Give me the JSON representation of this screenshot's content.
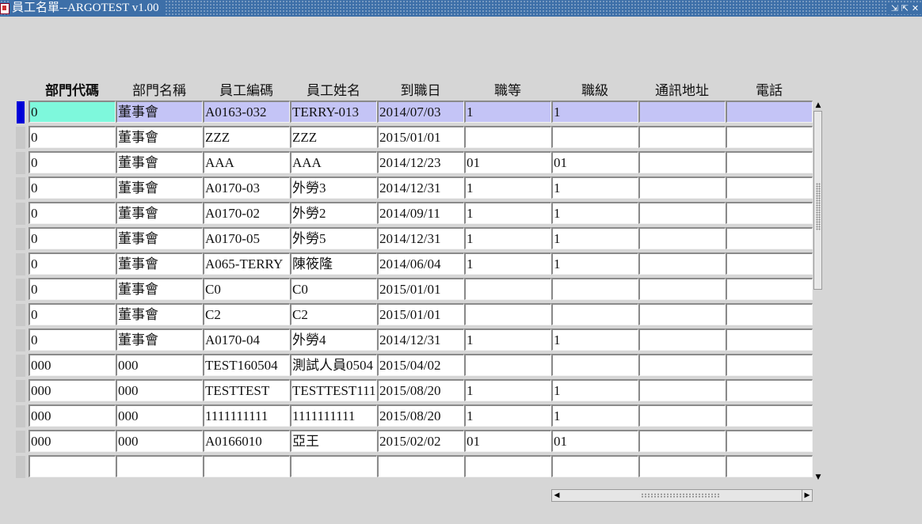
{
  "window": {
    "title": "員工名單--ARGOTEST v1.00",
    "buttons": [
      "⇲",
      "⇱",
      "✕"
    ]
  },
  "columns": [
    "部門代碼",
    "部門名稱",
    "員工編碼",
    "員工姓名",
    "到職日",
    "職等",
    "職級",
    "通訊地址",
    "電話"
  ],
  "rows": [
    [
      "0",
      "董事會",
      "A0163-032",
      "TERRY-013",
      "2014/07/03",
      "1",
      "1",
      "",
      ""
    ],
    [
      "0",
      "董事會",
      "ZZZ",
      "ZZZ",
      "2015/01/01",
      "",
      "",
      "",
      ""
    ],
    [
      "0",
      "董事會",
      "AAA",
      "AAA",
      "2014/12/23",
      "01",
      "01",
      "",
      ""
    ],
    [
      "0",
      "董事會",
      "A0170-03",
      "外勞3",
      "2014/12/31",
      "1",
      "1",
      "",
      ""
    ],
    [
      "0",
      "董事會",
      "A0170-02",
      "外勞2",
      "2014/09/11",
      "1",
      "1",
      "",
      ""
    ],
    [
      "0",
      "董事會",
      "A0170-05",
      "外勞5",
      "2014/12/31",
      "1",
      "1",
      "",
      ""
    ],
    [
      "0",
      "董事會",
      "A065-TERRY",
      "陳筱隆",
      "2014/06/04",
      "1",
      "1",
      "",
      ""
    ],
    [
      "0",
      "董事會",
      "C0",
      "C0",
      "2015/01/01",
      "",
      "",
      "",
      ""
    ],
    [
      "0",
      "董事會",
      "C2",
      "C2",
      "2015/01/01",
      "",
      "",
      "",
      ""
    ],
    [
      "0",
      "董事會",
      "A0170-04",
      "外勞4",
      "2014/12/31",
      "1",
      "1",
      "",
      ""
    ],
    [
      "000",
      "000",
      "TEST160504",
      "測試人員0504",
      "2015/04/02",
      "",
      "",
      "",
      ""
    ],
    [
      "000",
      "000",
      "TESTTEST",
      "TESTTEST111",
      "2015/08/20",
      "1",
      "1",
      "",
      ""
    ],
    [
      "000",
      "000",
      "1111111111",
      "1111111111",
      "2015/08/20",
      "1",
      "1",
      "",
      ""
    ],
    [
      "000",
      "000",
      "A0166010",
      "亞王",
      "2015/02/02",
      "01",
      "01",
      "",
      ""
    ],
    [
      "",
      "",
      "",
      "",
      "",
      "",
      "",
      "",
      ""
    ]
  ],
  "selected_row": 0,
  "colors": {
    "titlebar": "#3d6fa8",
    "selected_row": "#c4c4f6",
    "active_cell": "#7ef8dc",
    "record_indicator": "#0000d8"
  }
}
